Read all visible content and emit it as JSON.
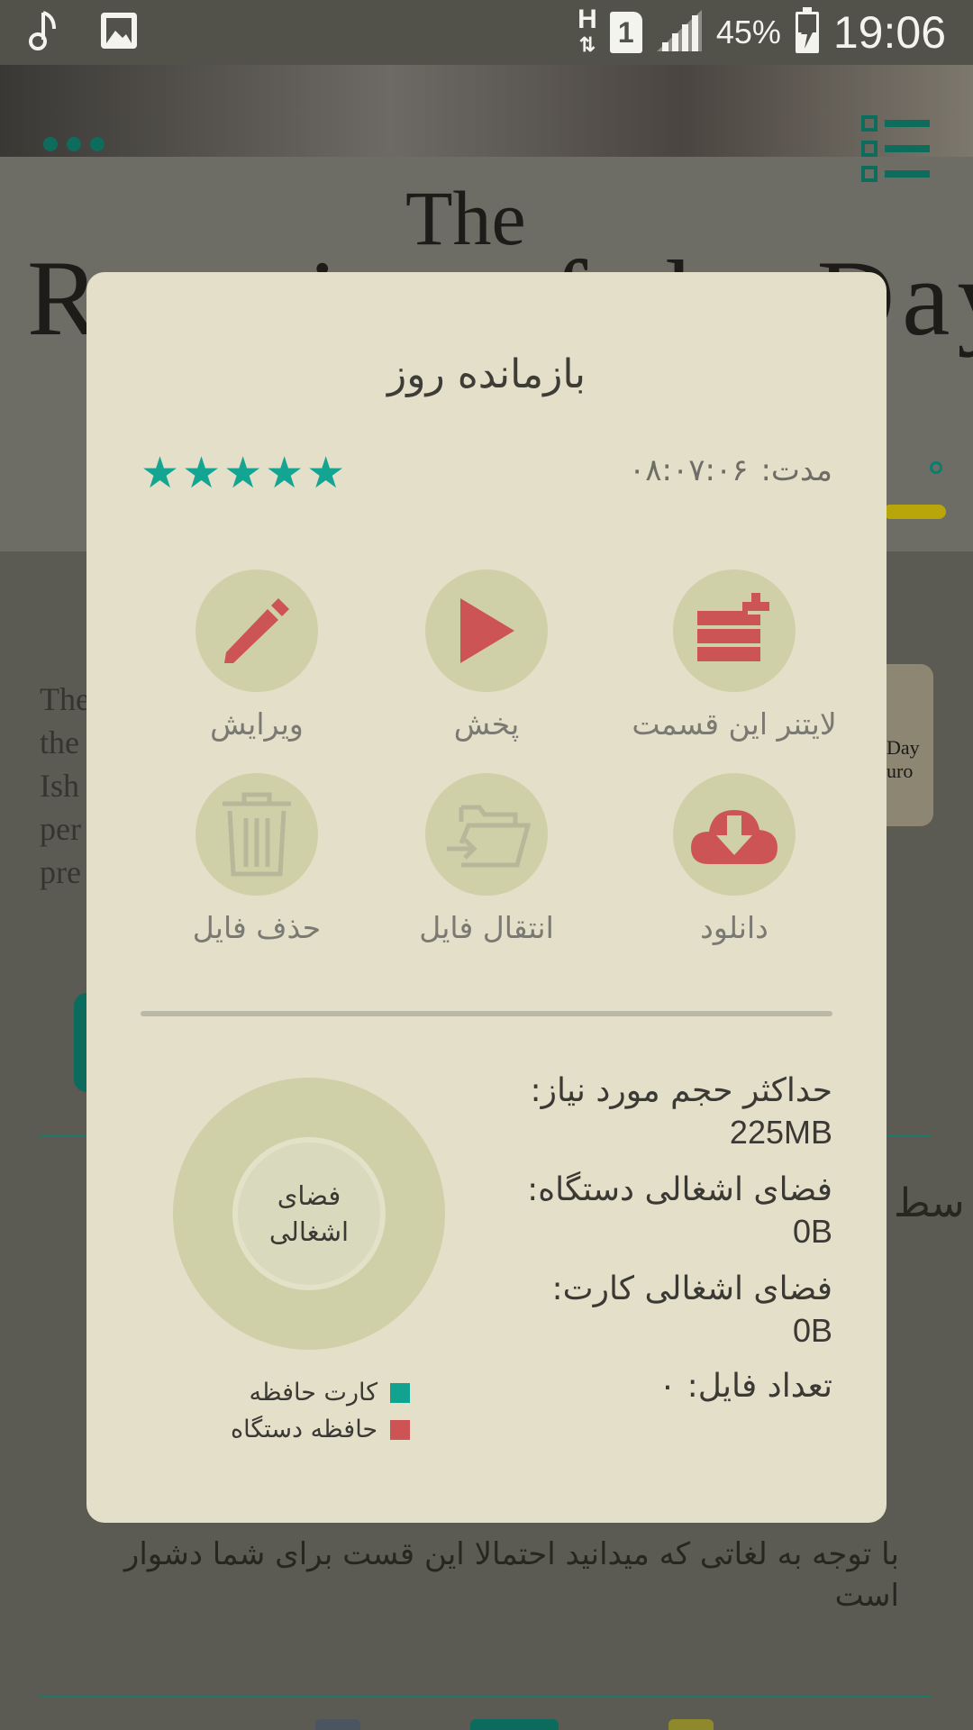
{
  "status_bar": {
    "network_type": "H",
    "sim_slot": "1",
    "battery_percent": "45%",
    "clock": "19:06",
    "icons": [
      "music-note-icon",
      "image-icon",
      "data-transfer-icon",
      "sim-icon",
      "signal-icon",
      "battery-charging-icon"
    ]
  },
  "background": {
    "hero_title_the": "The",
    "hero_title_main": "Remains of the Day",
    "description_lines": [
      "The",
      "the",
      "Ish",
      "per",
      "pre"
    ],
    "thumbnail_text": "Day\nuro",
    "side_heading": "سط",
    "note": "با توجه به لغاتی که میدانید احتمالا این قست برای شما دشوار است",
    "colors": {
      "accent": "#0e6c5d"
    }
  },
  "dialog": {
    "title": "بازمانده روز",
    "duration_label": "مدت:",
    "duration_value": "۰۸:۰۷:۰۶",
    "rating": 5,
    "rating_max": 5,
    "actions": [
      {
        "label": "لایتنر این قسمت",
        "icon": "leitner-add-icon",
        "enabled": true
      },
      {
        "label": "پخش",
        "icon": "play-icon",
        "enabled": true
      },
      {
        "label": "ویرایش",
        "icon": "pencil-icon",
        "enabled": true
      },
      {
        "label": "دانلود",
        "icon": "cloud-download-icon",
        "enabled": true
      },
      {
        "label": "انتقال فایل",
        "icon": "folder-move-icon",
        "enabled": false
      },
      {
        "label": "حذف فایل",
        "icon": "trash-icon",
        "enabled": false
      }
    ],
    "stats": {
      "max_size_label": "حداکثر حجم مورد نیاز:",
      "max_size_value": "225MB",
      "device_space_label": "فضای اشغالی دستگاه:",
      "device_space_value": "0B",
      "card_space_label": "فضای اشغالی کارت:",
      "card_space_value": "0B",
      "file_count_label": "تعداد فایل:",
      "file_count_value": "۰"
    },
    "donut": {
      "center_label": "فضای اشغالی",
      "legend": [
        {
          "label": "کارت حافظه",
          "color": "#12a390"
        },
        {
          "label": "حافظه دستگاه",
          "color": "#cc5454"
        }
      ]
    },
    "colors": {
      "background": "#e4dfc9",
      "icon_red": "#cc5454",
      "icon_circle": "#cfd0a8",
      "disabled_icon": "#b9b99b",
      "star": "#14a592"
    }
  }
}
